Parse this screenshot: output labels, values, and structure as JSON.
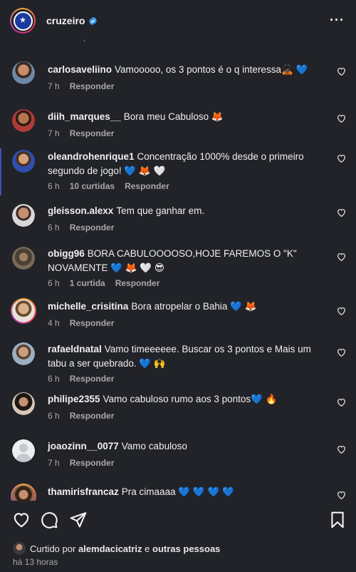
{
  "header": {
    "username": "cruzeiro",
    "more_icon": "more-icon"
  },
  "comments": [
    {
      "user": "carlosaveliino",
      "text": "Vamooooo, os 3 pontos é o q interessa🙇🏿 💙",
      "time": "7 h",
      "likes": "",
      "reply": "Responder"
    },
    {
      "user": "diih_marques__",
      "text": "Bora meu Cabuloso 🦊",
      "time": "7 h",
      "likes": "",
      "reply": "Responder"
    },
    {
      "user": "oleandrohenrique1",
      "text": "Concentração 1000% desde o primeiro segundo de jogo! 💙 🦊 🤍",
      "time": "6 h",
      "likes": "10 curtidas",
      "reply": "Responder"
    },
    {
      "user": "gleisson.alexx",
      "text": "Tem que ganhar em.",
      "time": "6 h",
      "likes": "",
      "reply": "Responder"
    },
    {
      "user": "obigg96",
      "text": "BORA CABULOOOOSO,HOJE FAREMOS O \"K\" NOVAMENTE 💙 🦊 🤍 😎",
      "time": "6 h",
      "likes": "1 curtida",
      "reply": "Responder"
    },
    {
      "user": "michelle_crisitina",
      "text": "Bora atropelar o Bahia 💙 🦊",
      "time": "4 h",
      "likes": "",
      "reply": "Responder"
    },
    {
      "user": "rafaeldnatal",
      "text": "Vamo timeeeeee. Buscar os 3 pontos e Mais um tabu a ser quebrado. 💙 🙌",
      "time": "6 h",
      "likes": "",
      "reply": "Responder"
    },
    {
      "user": "philipe2355",
      "text": "Vamo cabuloso rumo aos 3 pontos💙 🔥",
      "time": "6 h",
      "likes": "",
      "reply": "Responder"
    },
    {
      "user": "joaozinn__0077",
      "text": "Vamo cabuloso",
      "time": "7 h",
      "likes": "",
      "reply": "Responder"
    },
    {
      "user": "thamirisfrancaz",
      "text": "Pra cimaaaa 💙 💙 💙 💙",
      "time": "",
      "likes": "",
      "reply": ""
    }
  ],
  "footer": {
    "liked_prefix": "Curtido por",
    "liked_user": "alemdacicatriz",
    "liked_mid": "e",
    "liked_others": "outras pessoas",
    "posted_time": "há 13 horas"
  },
  "colors": {
    "background": "#212328",
    "heart_blue": "#3b7ff0",
    "verified": "#3897f0"
  }
}
